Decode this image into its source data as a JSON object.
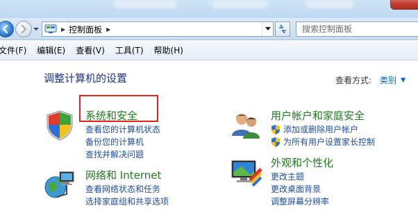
{
  "window": {
    "controls": {
      "close_icon": "close-icon"
    }
  },
  "navigation": {
    "back_icon": "back-arrow-icon",
    "forward_icon": "forward-arrow-icon",
    "breadcrumb": [
      "控制面板"
    ],
    "address_icon": "control-panel-icon",
    "search_placeholder": "搜索控制面板"
  },
  "menu": {
    "items": [
      {
        "label": "文件(F)"
      },
      {
        "label": "编辑(E)"
      },
      {
        "label": "查看(V)"
      },
      {
        "label": "工具(T)"
      },
      {
        "label": "帮助(H)"
      }
    ]
  },
  "main": {
    "title": "调整计算机的设置",
    "view_by_label": "查看方式:",
    "view_by_value": "类别",
    "categories": [
      {
        "title": "系统和安全",
        "icon": "shield-flag-icon",
        "links": [
          {
            "label": "查看您的计算机状态"
          },
          {
            "label": "备份您的计算机"
          },
          {
            "label": "查找并解决问题"
          }
        ]
      },
      {
        "title": "网络和 Internet",
        "icon": "network-globe-icon",
        "links": [
          {
            "label": "查看网络状态和任务"
          },
          {
            "label": "选择家庭组和共享选项"
          }
        ]
      },
      {
        "title": "用户帐户和家庭安全",
        "icon": "users-icon",
        "links": [
          {
            "label": "添加或删除用户帐户",
            "icon": "uac-shield-icon"
          },
          {
            "label": "为所有用户设置家长控制",
            "icon": "uac-shield-icon"
          }
        ]
      },
      {
        "title": "外观和个性化",
        "icon": "monitor-paint-icon",
        "links": [
          {
            "label": "更改主题"
          },
          {
            "label": "更改桌面背景"
          },
          {
            "label": "调整屏幕分辨率"
          }
        ]
      }
    ]
  },
  "colors": {
    "category_title": "#1d7a1d",
    "link": "#1e4ea0",
    "page_title": "#1e3287",
    "highlight": "#e0231f"
  }
}
